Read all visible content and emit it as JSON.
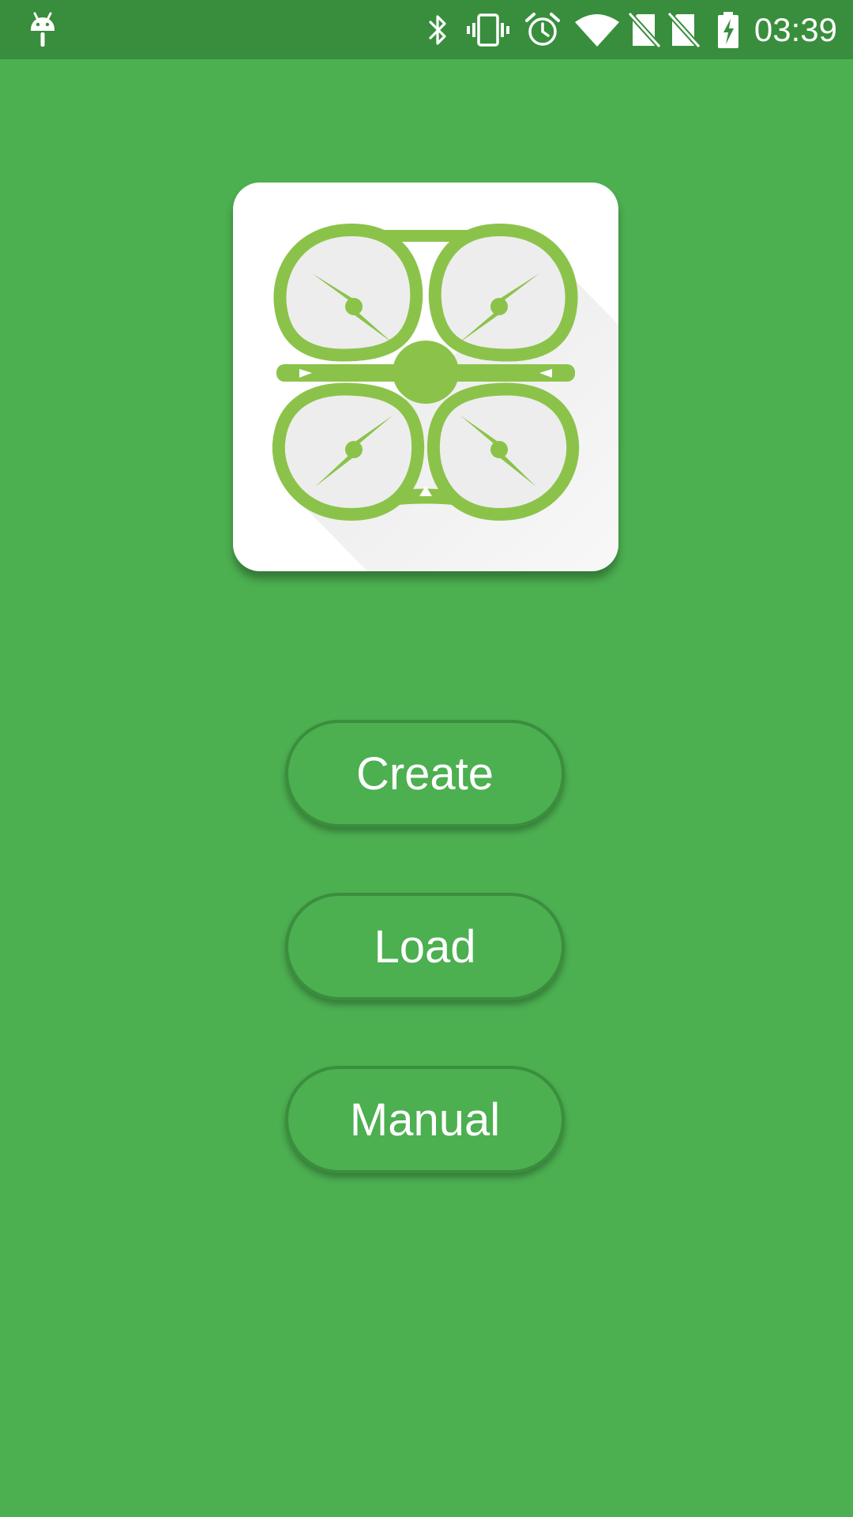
{
  "status_bar": {
    "time": "03:39",
    "icons": [
      "android-notification-icon",
      "bluetooth-icon",
      "vibrate-icon",
      "alarm-icon",
      "wifi-icon",
      "no-sim-icon",
      "no-sim-icon",
      "battery-charging-icon"
    ]
  },
  "logo": {
    "icon": "drone-icon",
    "brand_color": "#8BC34A"
  },
  "buttons": {
    "create": "Create",
    "load": "Load",
    "manual": "Manual"
  },
  "colors": {
    "background": "#4CAF50",
    "status_bar": "#388E3C",
    "button_border": "#3A8E3D",
    "text": "#FFFFFF"
  }
}
